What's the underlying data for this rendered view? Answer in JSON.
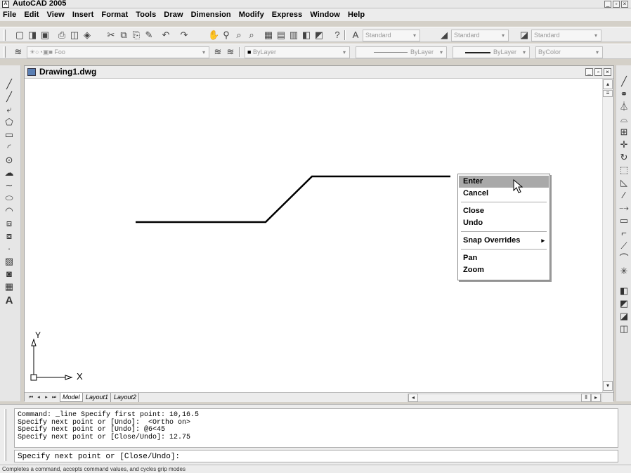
{
  "window": {
    "title": "AutoCAD 2005",
    "icon": "autocad-icon"
  },
  "menu": [
    "File",
    "Edit",
    "View",
    "Insert",
    "Format",
    "Tools",
    "Draw",
    "Dimension",
    "Modify",
    "Express",
    "Window",
    "Help"
  ],
  "toolbar": {
    "text_style": "Standard",
    "dim_style": "Standard",
    "table_style": "Standard",
    "layer": "Foo",
    "color": "ByLayer",
    "linetype": "ByLayer",
    "lineweight": "ByLayer",
    "plot_style": "ByColor"
  },
  "drawing": {
    "title": "Drawing1.dwg",
    "tabs": [
      "Model",
      "Layout1",
      "Layout2"
    ],
    "ucs_x": "X",
    "ucs_y": "Y",
    "line_color": "#000000"
  },
  "context_menu": {
    "items": [
      "Enter",
      "Cancel",
      "Close",
      "Undo",
      "Snap Overrides",
      "Pan",
      "Zoom"
    ],
    "highlighted": "Enter",
    "submenu_arrow": "▸"
  },
  "command": {
    "history": [
      "Command: _line Specify first point: 10,16.5",
      "Specify next point or [Undo]:  <Ortho on>",
      "Specify next point or [Undo]: @6<45",
      "Specify next point or [Close/Undo]: 12.75"
    ],
    "prompt": "Specify next point or [Close/Undo]:"
  },
  "status": "Completes a command, accepts command values, and cycles grip modes"
}
